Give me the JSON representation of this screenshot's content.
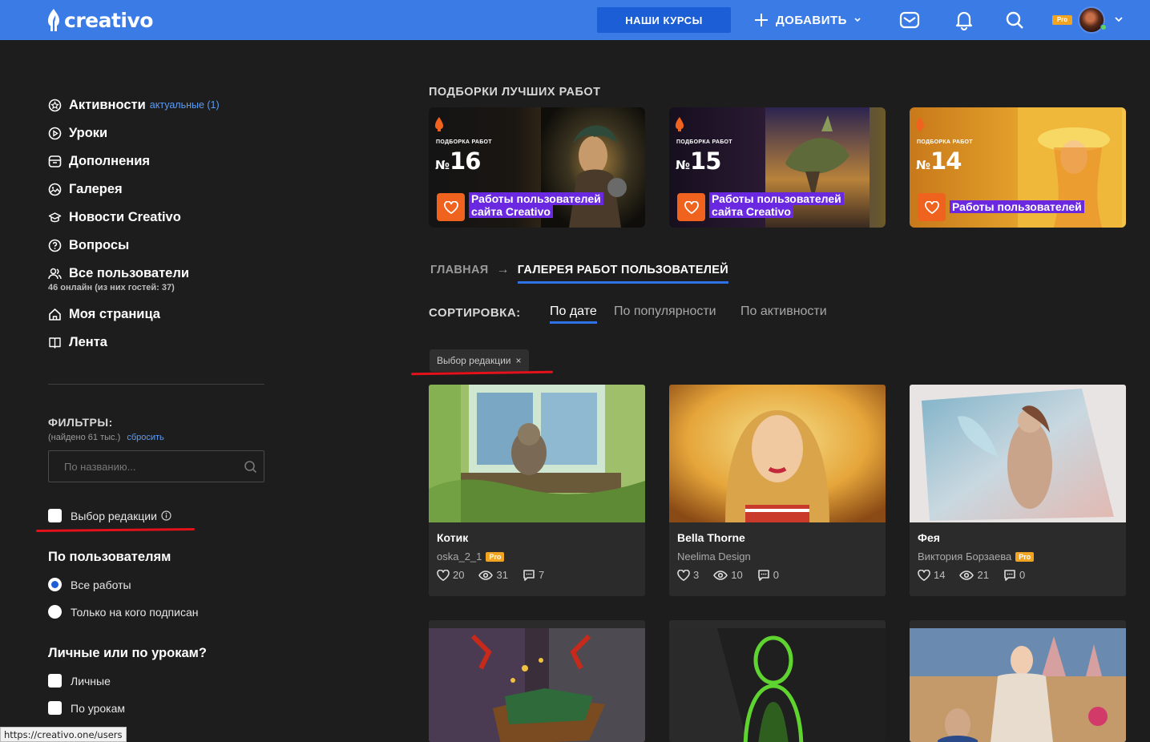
{
  "header": {
    "logo_text": "creativo",
    "courses_label": "НАШИ КУРСЫ",
    "add_label": "ДОБАВИТЬ",
    "pro_badge": "Pro",
    "accent": "#3a7be6"
  },
  "sidebar": {
    "nav": [
      {
        "label": "Активности",
        "sub": "актуальные (1)",
        "icon": "activity-icon"
      },
      {
        "label": "Уроки",
        "icon": "play-icon"
      },
      {
        "label": "Дополнения",
        "icon": "addons-icon"
      },
      {
        "label": "Галерея",
        "icon": "gallery-icon"
      },
      {
        "label": "Новости Creativo",
        "icon": "news-icon"
      },
      {
        "label": "Вопросы",
        "icon": "question-icon"
      },
      {
        "label": "Все пользователи",
        "hint": "46 онлайн (из них гостей: 37)",
        "icon": "users-icon"
      },
      {
        "label": "Моя страница",
        "icon": "home-icon"
      },
      {
        "label": "Лента",
        "icon": "feed-icon"
      }
    ],
    "filters": {
      "title": "ФИЛЬТРЫ:",
      "found": "(найдено 61 тыс.)",
      "reset": "сбросить",
      "search_placeholder": "По названию...",
      "editors_choice": "Выбор редакции",
      "by_users_title": "По пользователям",
      "by_users": [
        "Все работы",
        "Только на кого подписан"
      ],
      "personal_title": "Личные или по урокам?",
      "personal": [
        "Личные",
        "По урокам"
      ]
    }
  },
  "main": {
    "collections_title": "ПОДБОРКИ ЛУЧШИХ РАБОТ",
    "banners": [
      {
        "mini": "ПОДБОРКА РАБОТ",
        "num_prefix": "№",
        "num": "16",
        "line1": "Работы пользователей",
        "line2": "сайта Creativo"
      },
      {
        "mini": "ПОДБОРКА РАБОТ",
        "num_prefix": "№",
        "num": "15",
        "line1": "Работы пользователей",
        "line2": "сайта Creativo"
      },
      {
        "mini": "ПОДБОРКА РАБОТ",
        "num_prefix": "№",
        "num": "14",
        "line1": "Работы пользователей",
        "line2": ""
      }
    ],
    "breadcrumb": {
      "home": "ГЛАВНАЯ",
      "arrow": "→",
      "current": "ГАЛЕРЕЯ РАБОТ ПОЛЬЗОВАТЕЛЕЙ"
    },
    "sort": {
      "label": "СОРТИРОВКА:",
      "tabs": [
        "По дате",
        "По популярности",
        "По активности"
      ]
    },
    "active_tag": "Выбор редакции",
    "tag_close": "×",
    "cards": [
      {
        "title": "Котик",
        "author": "oska_2_1",
        "pro": "Pro",
        "likes": "20",
        "views": "31",
        "comments": "7"
      },
      {
        "title": "Bella Thorne",
        "author": "Neelima Design",
        "pro": "",
        "likes": "3",
        "views": "10",
        "comments": "0"
      },
      {
        "title": "Фея",
        "author": "Виктория Борзаева",
        "pro": "Pro",
        "likes": "14",
        "views": "21",
        "comments": "0"
      }
    ]
  },
  "status_bar_url": "https://creativo.one/users"
}
